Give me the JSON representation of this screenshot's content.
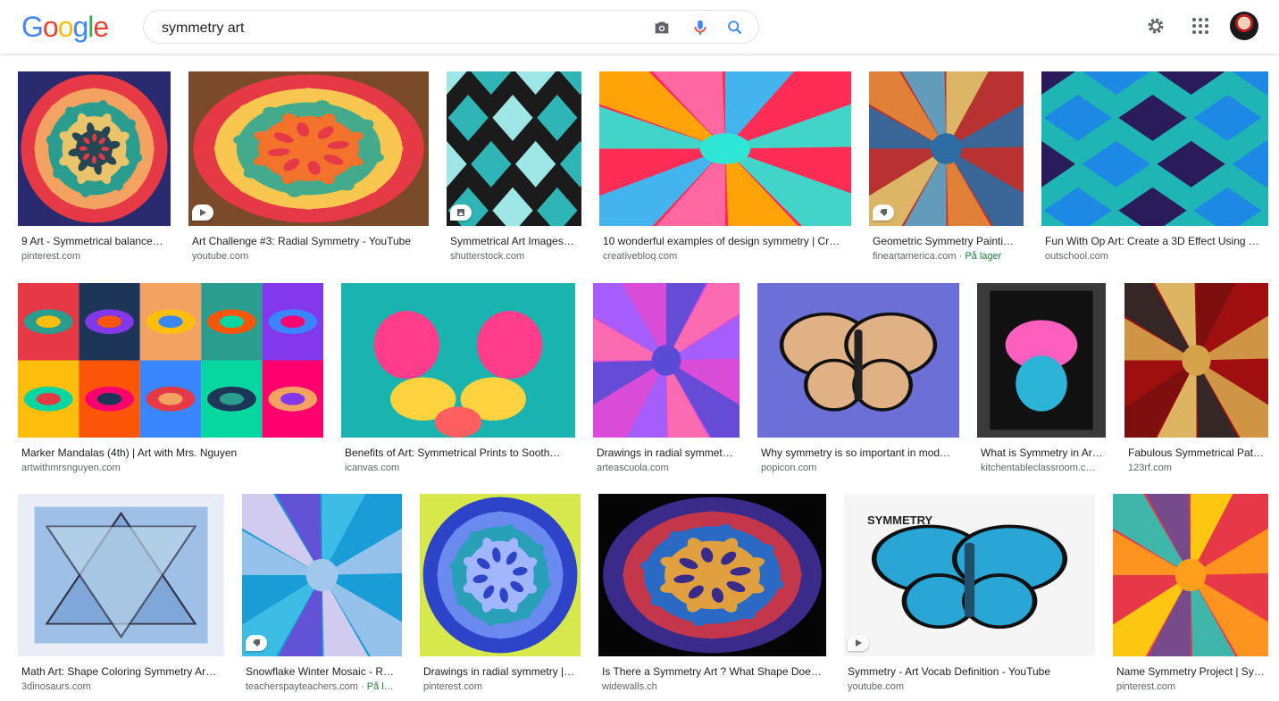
{
  "header": {
    "logo": "Google",
    "search_value": "symmetry art",
    "icons": [
      "camera-icon",
      "mic-icon",
      "search-icon",
      "gear-icon",
      "apps-icon",
      "avatar"
    ]
  },
  "results": [
    {
      "title": "9 Art - Symmetrical balance…",
      "domain": "pinterest.com",
      "badge": null
    },
    {
      "title": "Art Challenge #3: Radial Symmetry - YouTube",
      "domain": "youtube.com",
      "badge": "play-icon"
    },
    {
      "title": "Symmetrical Art Images…",
      "domain": "shutterstock.com",
      "badge": "image-icon"
    },
    {
      "title": "10 wonderful examples of design symmetry | Cr…",
      "domain": "creativebloq.com",
      "badge": null
    },
    {
      "title": "Geometric Symmetry Painti…",
      "domain": "fineartamerica.com",
      "stock": "På lager",
      "badge": "tag-icon"
    },
    {
      "title": "Fun With Op Art: Create a 3D Effect Using …",
      "domain": "outschool.com",
      "badge": null
    },
    {
      "title": "Marker Mandalas (4th) | Art with Mrs. Nguyen",
      "domain": "artwithmrsnguyen.com",
      "badge": null
    },
    {
      "title": "Benefits of Art: Symmetrical Prints to Sooth…",
      "domain": "icanvas.com",
      "badge": null
    },
    {
      "title": "Drawings in radial symmet…",
      "domain": "arteascuola.com",
      "badge": null
    },
    {
      "title": "Why symmetry is so important in mod…",
      "domain": "popicon.com",
      "badge": null
    },
    {
      "title": "What is Symmetry in Ar…",
      "domain": "kitchentableclassroom.c…",
      "badge": null
    },
    {
      "title": "Fabulous Symmetrical Pat…",
      "domain": "123rf.com",
      "badge": null
    },
    {
      "title": "Math Art: Shape Coloring Symmetry Ar…",
      "domain": "3dinosaurs.com",
      "badge": null
    },
    {
      "title": "Snowflake Winter Mosaic - R…",
      "domain": "teacherspayteachers.com",
      "stock": "På l…",
      "badge": "tag-icon"
    },
    {
      "title": "Drawings in radial symmetry |…",
      "domain": "pinterest.com",
      "badge": null
    },
    {
      "title": "Is There a Symmetry Art ? What Shape Doe…",
      "domain": "widewalls.ch",
      "badge": null
    },
    {
      "title": "Symmetry - Art Vocab Definition - YouTube",
      "domain": "youtube.com",
      "badge": "play-icon",
      "image_text": "SYMMETRY"
    },
    {
      "title": "Name Symmetry Project | Sy…",
      "domain": "pinterest.com",
      "badge": null
    }
  ],
  "colors": {
    "link": "#202124",
    "domain": "#5f6368",
    "stock": "#188038",
    "search_blue": "#4285f4"
  }
}
